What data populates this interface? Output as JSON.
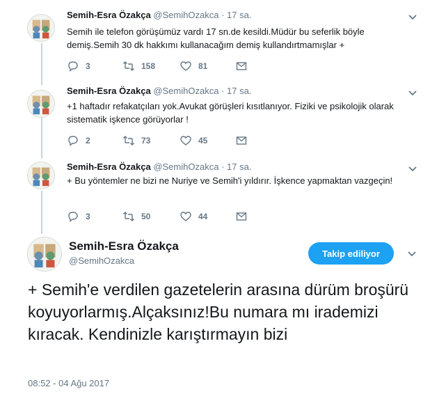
{
  "thread": [
    {
      "name": "Semih-Esra Özakça",
      "handle": "@SemihOzakca",
      "dot": "·",
      "time": "17 sa.",
      "text": "Semih ile telefon görüşümüz vardı 17 sn.de kesildi.Müdür bu seferlik böyle demiş.Semih 30 dk hakkımı kullanacağım demiş kullandırtmamışlar +",
      "replies": "3",
      "retweets": "158",
      "likes": "81"
    },
    {
      "name": "Semih-Esra Özakça",
      "handle": "@SemihOzakca",
      "dot": "·",
      "time": "17 sa.",
      "text": "+1 haftadır refakatçıları yok.Avukat görüşleri kısıtlanıyor. Fiziki ve psikolojik olarak sistematik işkence görüyorlar !",
      "replies": "2",
      "retweets": "73",
      "likes": "45"
    },
    {
      "name": "Semih-Esra Özakça",
      "handle": "@SemihOzakca",
      "dot": "·",
      "time": "17 sa.",
      "text": "+ Bu yöntemler ne bizi ne Nuriye ve Semih'i yıldırır. İşkence yapmaktan vazgeçin!",
      "replies": "3",
      "retweets": "50",
      "likes": "44"
    }
  ],
  "main_tweet": {
    "name": "Semih-Esra Özakça",
    "handle": "@SemihOzakca",
    "follow_label": "Takip ediliyor",
    "text": "+ Semih'e verdilen gazetelerin arasına dürüm broşürü koyuyorlarmış.Alçaksınız!Bu numara mı irademizi kıracak. Kendinizle karıştırmayın bizi",
    "date": "08:52 - 04 Ağu 2017"
  },
  "colors": {
    "accent": "#1da1f2",
    "secondary_text": "#657786",
    "thread_line": "#c4d4e0"
  },
  "icons": [
    "reply-icon",
    "retweet-icon",
    "like-icon",
    "direct-message-icon",
    "chevron-down-icon"
  ]
}
